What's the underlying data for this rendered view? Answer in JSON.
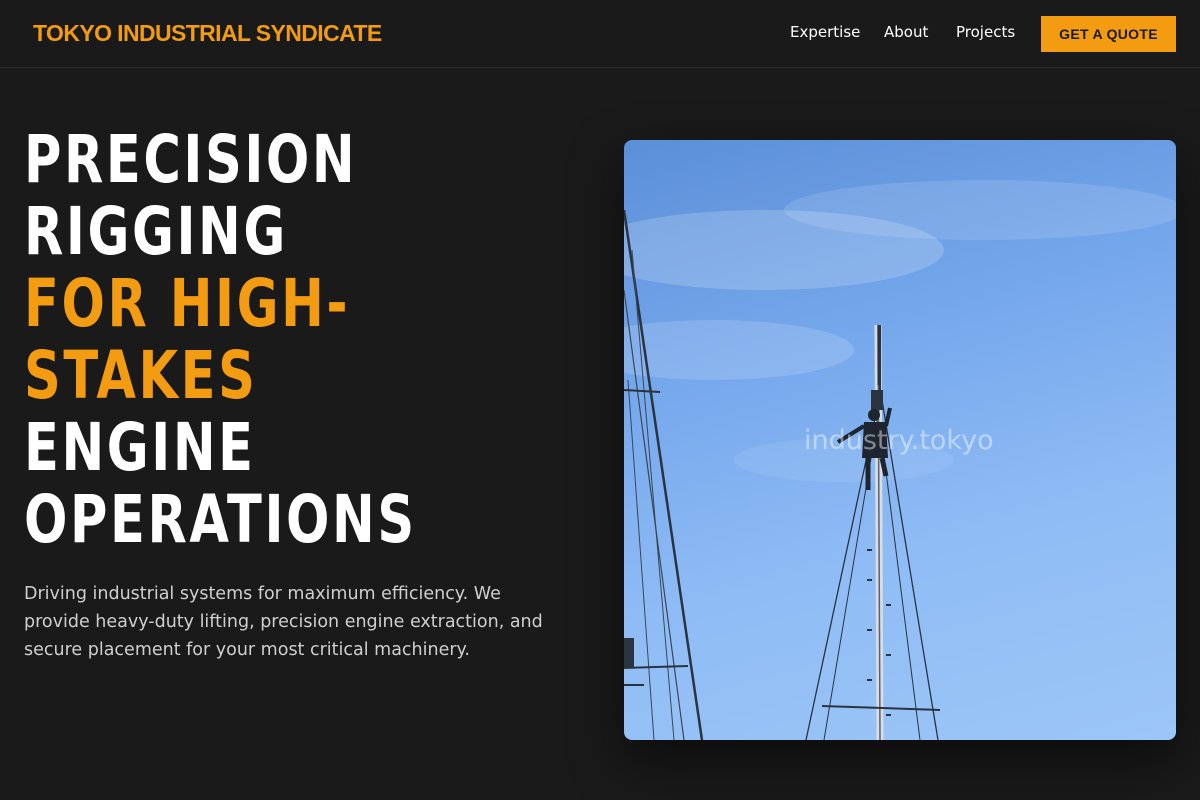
{
  "nav": {
    "brand": "TOKYO INDUSTRIAL SYNDICATE",
    "links": [
      "Expertise",
      "About",
      "Projects"
    ],
    "cta_label": "GET A QUOTE"
  },
  "hero": {
    "title_lines": [
      {
        "text": "PRECISION",
        "accent": false
      },
      {
        "text": "RIGGING",
        "accent": false
      },
      {
        "text": "FOR HIGH-",
        "accent": true
      },
      {
        "text": "STAKES",
        "accent": true
      },
      {
        "text": "ENGINE",
        "accent": false
      },
      {
        "text": "OPERATIONS",
        "accent": false
      }
    ],
    "description": "Driving industrial systems for maximum efficiency. We provide heavy-duty lifting, precision engine extraction, and secure placement for your most critical machinery.",
    "image_watermark": "industry.tokyo"
  },
  "colors": {
    "background": "#1a1a1a",
    "accent": "#f39c12",
    "text": "#ffffff",
    "muted_text": "#cfcfcf"
  }
}
